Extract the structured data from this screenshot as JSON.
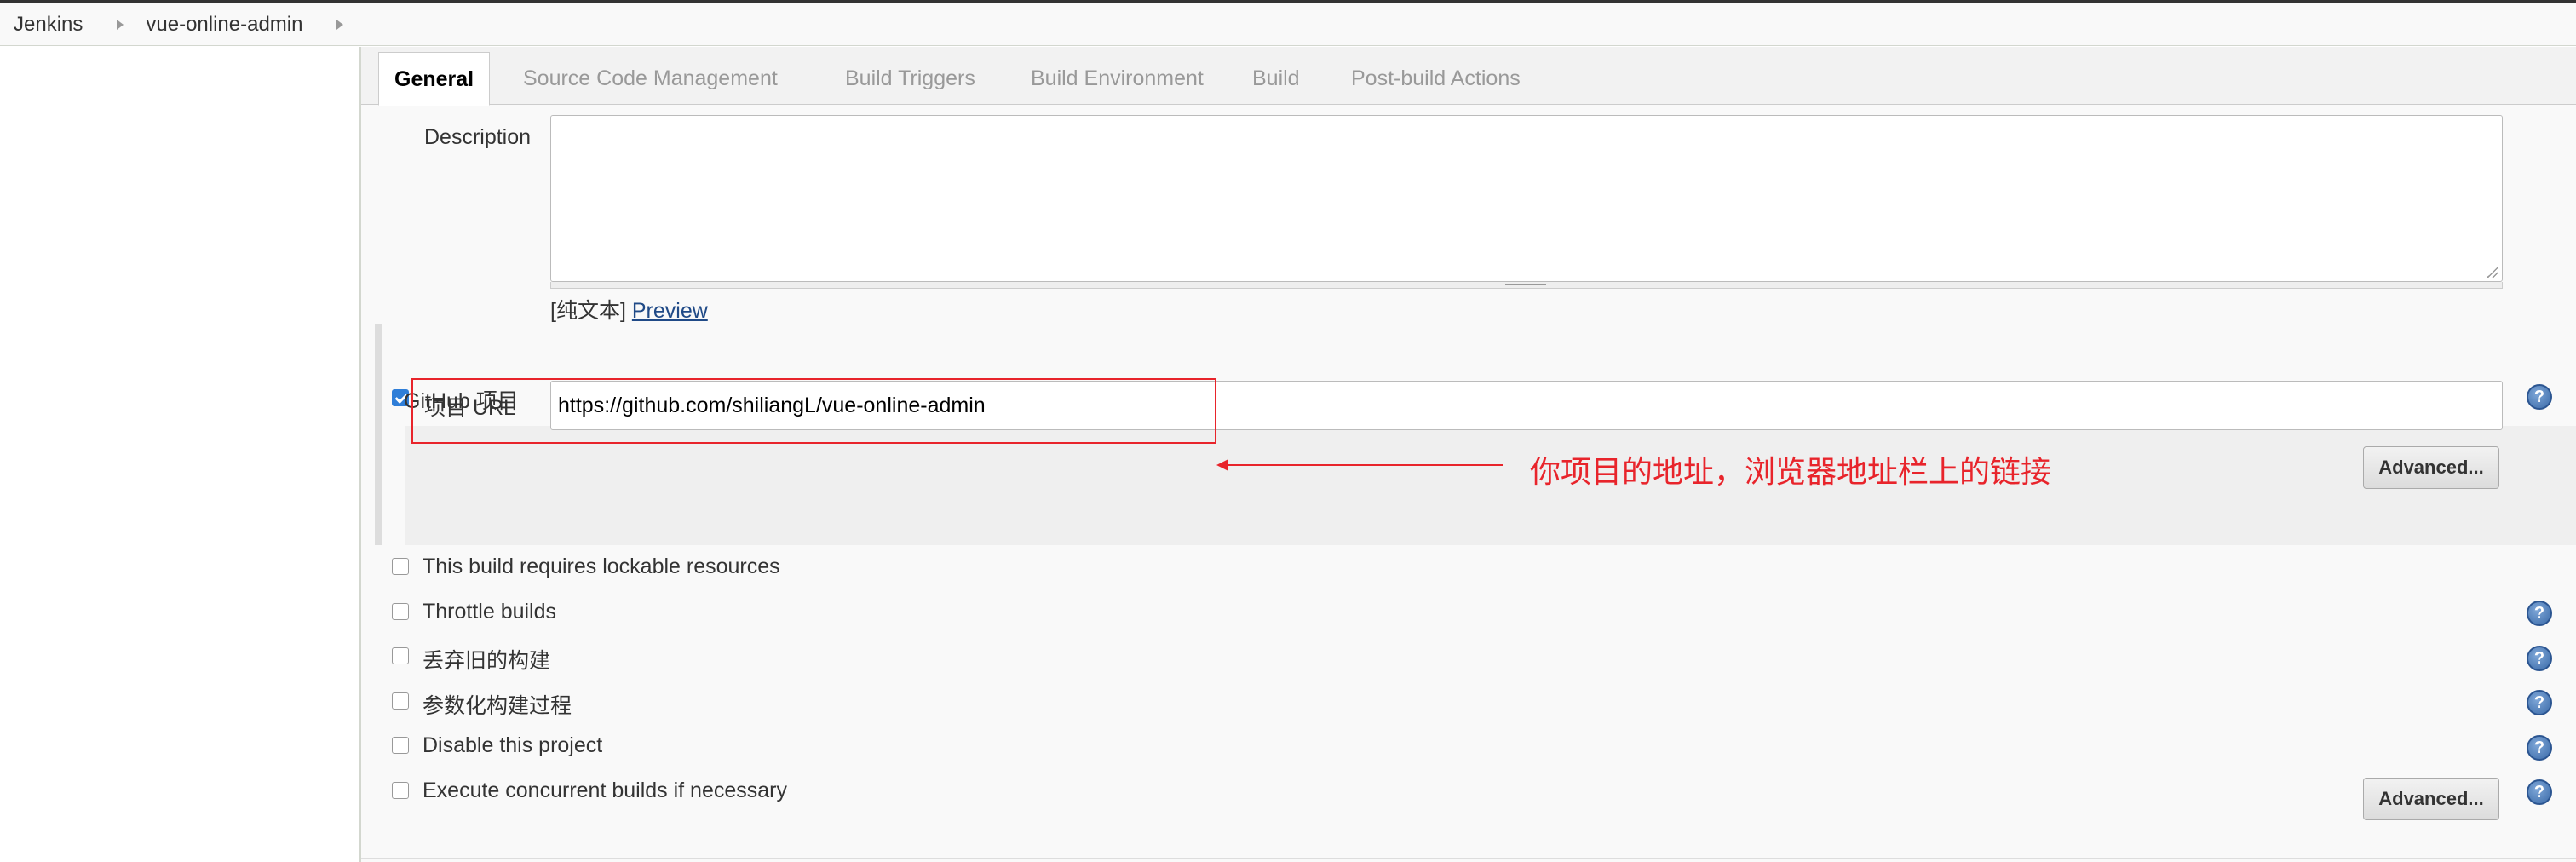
{
  "breadcrumb": {
    "items": [
      "Jenkins",
      "vue-online-admin"
    ]
  },
  "tabs": [
    "General",
    "Source Code Management",
    "Build Triggers",
    "Build Environment",
    "Build",
    "Post-build Actions"
  ],
  "description": {
    "label": "Description",
    "value": "",
    "format_text": "[纯文本]",
    "preview_link": "Preview"
  },
  "github": {
    "checkbox_label": "GitHub 项目",
    "checked": true,
    "url_label": "项目 URL",
    "url_value": "https://github.com/shiliangL/vue-online-admin",
    "advanced_label": "Advanced...",
    "annotation": "你项目的地址，浏览器地址栏上的链接"
  },
  "options": [
    {
      "label": "This build requires lockable resources",
      "checked": false,
      "help": false
    },
    {
      "label": "Throttle builds",
      "checked": false,
      "help": true
    },
    {
      "label": "丢弃旧的构建",
      "checked": false,
      "help": true
    },
    {
      "label": "参数化构建过程",
      "checked": false,
      "help": true
    },
    {
      "label": "Disable this project",
      "checked": false,
      "help": true
    },
    {
      "label": "Execute concurrent builds if necessary",
      "checked": false,
      "help": true
    }
  ],
  "bottom_advanced_label": "Advanced...",
  "help_glyph": "?",
  "colors": {
    "annotation": "#e8242b",
    "checkbox_checked": "#2f7ed8",
    "link": "#204a87"
  }
}
